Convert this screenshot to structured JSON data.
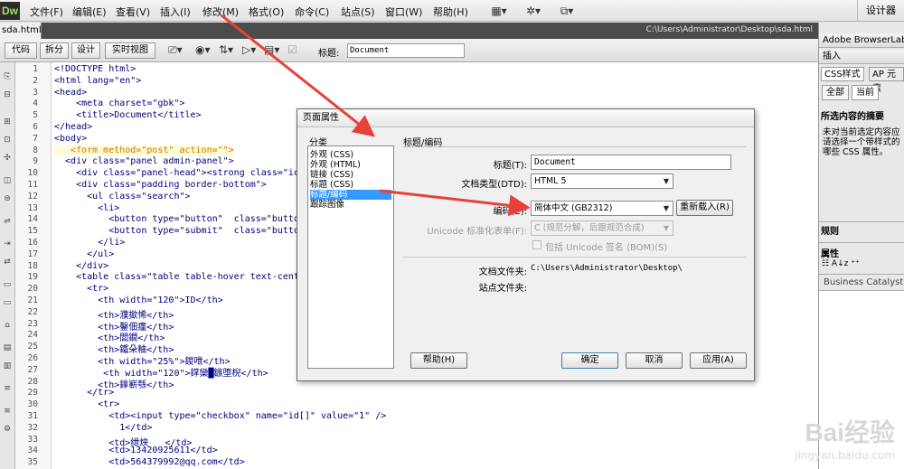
{
  "app": {
    "logo": "Dw"
  },
  "menu": [
    "文件(F)",
    "编辑(E)",
    "查看(V)",
    "插入(I)",
    "修改(M)",
    "格式(O)",
    "命令(C)",
    "站点(S)",
    "窗口(W)",
    "帮助(H)"
  ],
  "toolbar_icons": [
    "layout-icon",
    "gear-icon",
    "sitemap-icon"
  ],
  "workspace": "设计器",
  "document": {
    "tab": "sda.html",
    "path": "C:\\Users\\Administrator\\Desktop\\sda.html",
    "view_buttons": [
      "代码",
      "拆分",
      "设计",
      "实时视图"
    ],
    "title_label": "标题:",
    "title_value": "Document"
  },
  "line_numbers": [
    "1",
    "2",
    "3",
    "4",
    "5",
    "6",
    "7",
    "8",
    "9",
    "10",
    "11",
    "12",
    "13",
    "14",
    "15",
    "16",
    "17",
    "18",
    "19",
    "20",
    "21",
    "22",
    "23",
    "24",
    "25",
    "26",
    "27",
    "28",
    "29",
    "30",
    "31",
    "32",
    "33",
    "34",
    "35"
  ],
  "code_lines": [
    "<!DOCTYPE html>",
    "<html lang=\"en\">",
    "<head>",
    "    <meta charset=\"gbk\">",
    "    <title>Document</title>",
    "</head>",
    "<body>",
    "   <form method=\"post\" action=\"\">",
    "  <div class=\"panel admin-panel\">",
    "    <div class=\"panel-head\"><strong class=\"ic",
    "    <div class=\"padding border-bottom\">",
    "      <ul class=\"search\">",
    "        <li>",
    "          <button type=\"button\"  class=\"butto",
    "          <button type=\"submit\"  class=\"button",
    "        </li>",
    "      </ul>",
    "    </div>",
    "    <table class=\"table table-hover text-cent",
    "      <tr>",
    "        <th width=\"120\">ID</th>",
    "        <th>濮撳悕</th>",
    "        <th>鑿佃瘽</th>",
    "        <th>閭鐗</th>",
    "        <th>鐵朵粬</th>",
    "        <th width=\"25%\">鍐呭</th>",
    "         <th width=\"120\">鐣欒█鏃堕棿</th>",
    "        <th>鎿嶄綔</th>",
    "      </tr>",
    "        <tr>",
    "          <td><input type=\"checkbox\" name=\"id[]\" value=\"1\" />",
    "            1</td>",
    "          <td>绁炴   </td>",
    "          <td>13420925611</td>",
    "          <td>564379992@qq.com</td>"
  ],
  "right_panel": {
    "header": "Adobe BrowserLab",
    "insert_tab": "插入",
    "css_tab": "CSS样式",
    "ap_tab": "AP 元素",
    "all_button": "全部",
    "current_button": "当前",
    "summary_title": "所选内容的摘要",
    "summary_text": [
      "未对当前选定内容应",
      "请选择一个带样式的",
      "哪些 CSS 属性。"
    ],
    "rules_title": "规则",
    "props_title": "属性",
    "business": "Business Catalyst"
  },
  "dialog": {
    "title": "页面属性",
    "category_label": "分类",
    "categories": [
      "外观 (CSS)",
      "外观 (HTML)",
      "链接 (CSS)",
      "标题 (CSS)",
      "标题/编码",
      "跟踪图像"
    ],
    "selected_category": 4,
    "section_title": "标题/编码",
    "title_label": "标题(T):",
    "title_value": "Document",
    "doctype_label": "文档类型(DTD):",
    "doctype_value": "HTML 5",
    "encoding_label": "编码(E):",
    "encoding_value": "简体中文 (GB2312)",
    "reload_button": "重新载入(R)",
    "unicode_label": "Unicode 标准化表单(F):",
    "unicode_value": "C (规范分解，后跟规范合成)",
    "bom_label": "包括 Unicode 签名 (BOM)(S)",
    "docfolder_label": "文档文件夹:",
    "docfolder_value": "C:\\Users\\Administrator\\Desktop\\",
    "sitefolder_label": "站点文件夹:",
    "help_button": "帮助(H)",
    "ok_button": "确定",
    "cancel_button": "取消",
    "apply_button": "应用(A)"
  },
  "watermark": {
    "brand": "Bai经验",
    "url": "jingyan.baidu.com"
  },
  "colors": {
    "selection": "#3399ff",
    "arrow": "#e8403a",
    "code_tag": "#000080",
    "code_attr": "#cc7a00"
  }
}
